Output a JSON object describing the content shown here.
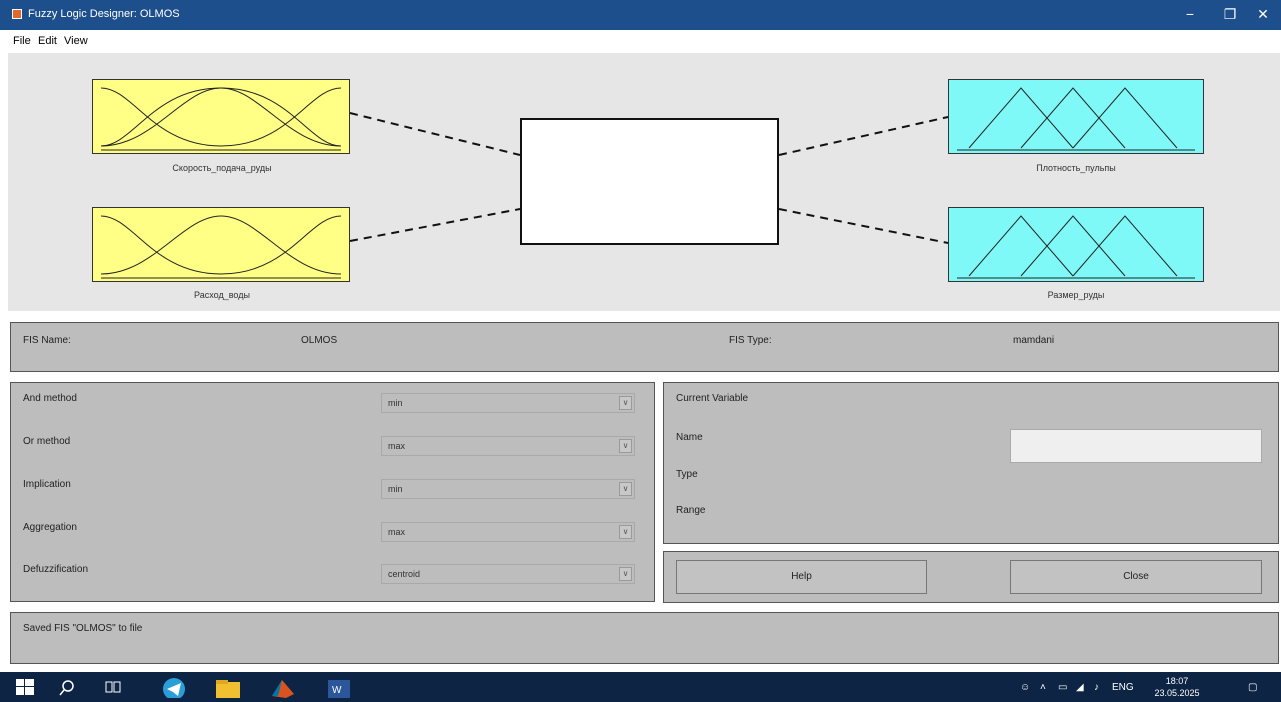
{
  "window": {
    "title": "Fuzzy Logic Designer: OLMOS",
    "controls": [
      "−",
      "❐",
      "✕"
    ]
  },
  "menu": [
    "File",
    "Edit",
    "View"
  ],
  "inputs": [
    {
      "label": "Скорость_подача_руды"
    },
    {
      "label": "Расход_воды"
    }
  ],
  "outputs": [
    {
      "label": "Плотность_пульпы"
    },
    {
      "label": "Размер_руды"
    }
  ],
  "fis": {
    "name_label": "FIS Name:",
    "name": "OLMOS",
    "type_label": "FIS Type:",
    "type": "mamdani"
  },
  "methods": [
    {
      "label": "And method",
      "value": "min"
    },
    {
      "label": "Or method",
      "value": "max"
    },
    {
      "label": "Implication",
      "value": "min"
    },
    {
      "label": "Aggregation",
      "value": "max"
    },
    {
      "label": "Defuzzification",
      "value": "centroid"
    }
  ],
  "current_variable": {
    "header": "Current Variable",
    "name_label": "Name",
    "type_label": "Type",
    "range_label": "Range",
    "name_value": ""
  },
  "buttons": {
    "help": "Help",
    "close": "Close"
  },
  "status": "Saved FIS \"OLMOS\" to file",
  "taskbar": {
    "lang": "ENG",
    "time": "18:07",
    "date": "23.05.2025"
  },
  "colors": {
    "input_box": "#ffff86",
    "output_box": "#7ff8f8",
    "title_bar": "#1c4f8c",
    "taskbar": "#0d2444"
  }
}
